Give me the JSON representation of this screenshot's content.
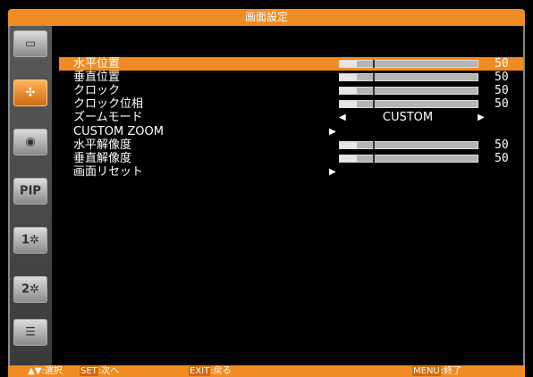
{
  "window": {
    "title": "画面設定"
  },
  "sidebar": {
    "items": [
      {
        "icon": "picture-icon",
        "glyph": "▭",
        "selected": false
      },
      {
        "icon": "screen-settings-icon",
        "glyph": "✣",
        "selected": true
      },
      {
        "icon": "audio-icon",
        "glyph": "◉",
        "selected": false
      },
      {
        "icon": "pip-icon",
        "glyph": "PIP",
        "selected": false
      },
      {
        "icon": "setup1-icon",
        "glyph": "1✲",
        "selected": false
      },
      {
        "icon": "setup2-icon",
        "glyph": "2✲",
        "selected": false
      },
      {
        "icon": "info-icon",
        "glyph": "☰",
        "selected": false
      }
    ]
  },
  "menu": {
    "items": [
      {
        "label": "水平位置",
        "type": "slider",
        "value": "50",
        "level": 0.5
      },
      {
        "label": "垂直位置",
        "type": "slider",
        "value": "50",
        "level": 0.5
      },
      {
        "label": "クロック",
        "type": "slider",
        "value": "50",
        "level": 0.5
      },
      {
        "label": "クロック位相",
        "type": "slider",
        "value": "50",
        "level": 0.5
      },
      {
        "label": "ズームモード",
        "type": "select",
        "value": "CUSTOM"
      },
      {
        "label": "CUSTOM ZOOM",
        "type": "submenu"
      },
      {
        "label": "水平解像度",
        "type": "slider",
        "value": "50",
        "level": 0.5
      },
      {
        "label": "垂直解像度",
        "type": "slider",
        "value": "50",
        "level": 0.5
      },
      {
        "label": "画面リセット",
        "type": "submenu"
      }
    ]
  },
  "footer": {
    "nav": "▲▼:選択",
    "set_key": "SET",
    "set_text": ":次へ",
    "exit_key": "EXIT",
    "exit_text": ":戻る",
    "menu_key": "MENU",
    "menu_text": ":終了"
  },
  "colors": {
    "accent": "#f08c23",
    "background": "#000000"
  }
}
